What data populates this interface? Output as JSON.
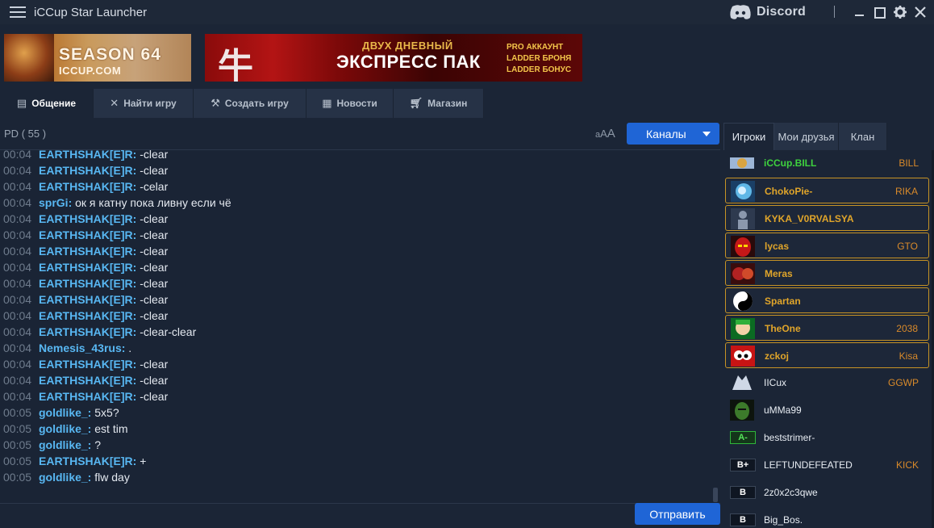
{
  "app": {
    "title": "iCCup Star Launcher"
  },
  "titlebar": {
    "discord_label": "Discord"
  },
  "banners": {
    "season": {
      "line1": "SEASON 64",
      "line2": "ICCUP.COM"
    },
    "express": {
      "glyph": "牛",
      "subtitle": "ДВУХ ДНЕВНЫЙ",
      "title": "ЭКСПРЕСС ПАК",
      "right": [
        "PRO АККАУНТ",
        "LADDER БРОНЯ",
        "LADDER БОНУС"
      ]
    }
  },
  "nav": {
    "tabs": [
      {
        "label": "Общение",
        "icon": "chat-icon"
      },
      {
        "label": "Найти игру",
        "icon": "swords-icon"
      },
      {
        "label": "Создать игру",
        "icon": "tools-icon"
      },
      {
        "label": "Новости",
        "icon": "news-icon"
      },
      {
        "label": "Магазин",
        "icon": "cart-icon"
      }
    ]
  },
  "channel": {
    "name": "PD",
    "count": "( 55 )",
    "font_small": "a",
    "font_mid": "A",
    "font_large": "A",
    "channels_button": "Каналы"
  },
  "chat": {
    "messages": [
      {
        "time": "00:04",
        "nick": "EARTHSHAK[E]R:",
        "text": " -clear"
      },
      {
        "time": "00:04",
        "nick": "EARTHSHAK[E]R:",
        "text": " -clear"
      },
      {
        "time": "00:04",
        "nick": "EARTHSHAK[E]R:",
        "text": " -celar"
      },
      {
        "time": "00:04",
        "nick": "sprGi:",
        "text": " ок я катну пока ливну если чё"
      },
      {
        "time": "00:04",
        "nick": "EARTHSHAK[E]R:",
        "text": " -clear"
      },
      {
        "time": "00:04",
        "nick": "EARTHSHAK[E]R:",
        "text": " -clear"
      },
      {
        "time": "00:04",
        "nick": "EARTHSHAK[E]R:",
        "text": " -clear"
      },
      {
        "time": "00:04",
        "nick": "EARTHSHAK[E]R:",
        "text": " -clear"
      },
      {
        "time": "00:04",
        "nick": "EARTHSHAK[E]R:",
        "text": " -clear"
      },
      {
        "time": "00:04",
        "nick": "EARTHSHAK[E]R:",
        "text": " -clear"
      },
      {
        "time": "00:04",
        "nick": "EARTHSHAK[E]R:",
        "text": " -clear"
      },
      {
        "time": "00:04",
        "nick": "EARTHSHAK[E]R:",
        "text": " -clear-clear"
      },
      {
        "time": "00:04",
        "nick": "Nemesis_43rus:",
        "text": " ."
      },
      {
        "time": "00:04",
        "nick": "EARTHSHAK[E]R:",
        "text": " -clear"
      },
      {
        "time": "00:04",
        "nick": "EARTHSHAK[E]R:",
        "text": " -clear"
      },
      {
        "time": "00:04",
        "nick": "EARTHSHAK[E]R:",
        "text": " -clear"
      },
      {
        "time": "00:05",
        "nick": "goldlike_:",
        "text": " 5x5?"
      },
      {
        "time": "00:05",
        "nick": "goldlike_:",
        "text": " est tim"
      },
      {
        "time": "00:05",
        "nick": "goldlike_:",
        "text": " ?"
      },
      {
        "time": "00:05",
        "nick": "EARTHSHAK[E]R:",
        "text": " +"
      },
      {
        "time": "00:05",
        "nick": "goldlike_:",
        "text": " flw day"
      }
    ],
    "send_button": "Отправить"
  },
  "players_panel": {
    "tabs": [
      "Игроки",
      "Мои друзья",
      "Клан"
    ],
    "players": [
      {
        "name": "iCCup.BILL",
        "clan": "BILL",
        "style": "green",
        "avatar": "admin-avatar"
      },
      {
        "name": "ChokoPie-",
        "clan": "RIKA",
        "style": "gold",
        "avatar": "dragon-avatar"
      },
      {
        "name": "KYKA_V0RVALSYA",
        "clan": "",
        "style": "gold",
        "avatar": "default-avatar"
      },
      {
        "name": "lycas",
        "clan": "GTO",
        "style": "gold",
        "avatar": "demon-avatar"
      },
      {
        "name": "Meras",
        "clan": "",
        "style": "gold",
        "avatar": "meras-avatar"
      },
      {
        "name": "Spartan",
        "clan": "",
        "style": "gold",
        "avatar": "yin-yang-avatar"
      },
      {
        "name": "TheOne",
        "clan": "2038",
        "style": "gold",
        "avatar": "cartoon-avatar"
      },
      {
        "name": "zckoj",
        "clan": "Kisa",
        "style": "gold",
        "avatar": "eyes-avatar"
      },
      {
        "name": "IICux",
        "clan": "GGWP",
        "style": "normal",
        "avatar": "wolf-avatar"
      },
      {
        "name": "uMMa99",
        "clan": "",
        "style": "normal",
        "avatar": "hulk-avatar"
      },
      {
        "name": "beststrimer-",
        "clan": "",
        "style": "normal",
        "rank": "A-"
      },
      {
        "name": "LEFTUNDEFEATED",
        "clan": "KICK",
        "style": "normal",
        "rank": "B+"
      },
      {
        "name": "2z0x2c3qwe",
        "clan": "",
        "style": "normal",
        "rank": "B"
      },
      {
        "name": "Big_Bos.",
        "clan": "",
        "style": "normal",
        "rank": "B"
      }
    ]
  },
  "colors": {
    "accent": "#1f65d6",
    "nick": "#58b7f2",
    "highlight": "#c79325",
    "admin_name": "#3ed23e"
  }
}
